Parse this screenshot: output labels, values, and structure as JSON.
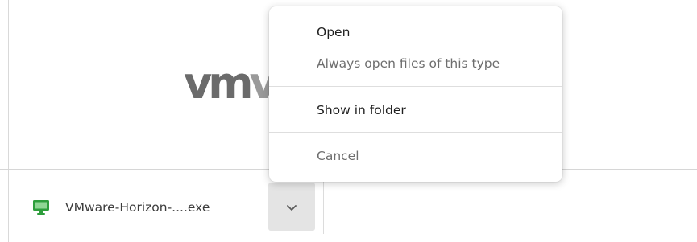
{
  "page": {
    "logo_main": "vm",
    "logo_fade": "v"
  },
  "download": {
    "file_name": "VMware-Horizon-....exe",
    "file_icon": "monitor-icon",
    "menu_toggle_icon": "chevron-down-icon"
  },
  "context_menu": {
    "items": [
      {
        "label": "Open"
      },
      {
        "label": "Always open files of this type"
      },
      {
        "label": "Show in folder"
      },
      {
        "label": "Cancel"
      }
    ]
  },
  "colors": {
    "accent_green": "#2e9e3c",
    "menu_toggle_bg": "#e4e4e4"
  }
}
